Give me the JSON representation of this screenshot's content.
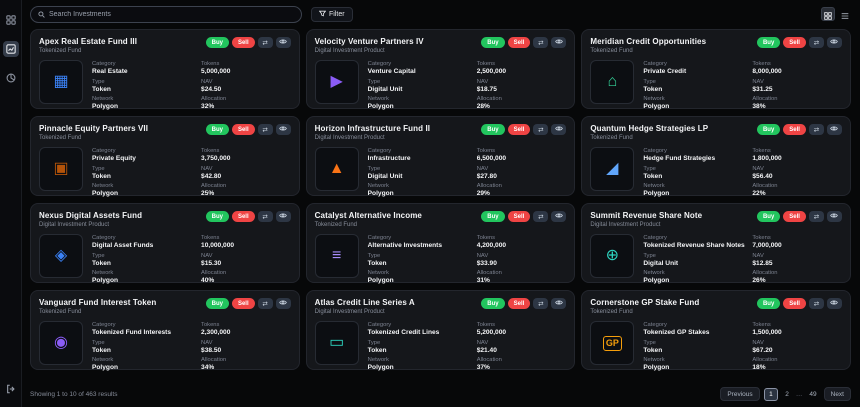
{
  "sidebar": {
    "items": [
      {
        "icon": "dashboard-icon",
        "active": false
      },
      {
        "icon": "investments-icon",
        "active": true
      },
      {
        "icon": "analytics-icon",
        "active": false
      }
    ],
    "logout_icon": "logout-icon"
  },
  "topbar": {
    "search_placeholder": "Search Investments",
    "filter_label": "Filter",
    "view_modes": [
      "grid",
      "list"
    ],
    "active_view": "grid"
  },
  "card_labels": {
    "category": "Category",
    "type": "Type",
    "network": "Network",
    "tokens": "Tokens",
    "nav": "NAV",
    "allocation": "Allocation",
    "buy": "Buy",
    "sell": "Sell"
  },
  "cards": [
    {
      "title": "Apex Real Estate Fund III",
      "subtitle": "Tokenized Fund",
      "category": "Real Estate",
      "tokens": "5,000,000",
      "type": "Token",
      "nav": "$24.50",
      "network": "Polygon",
      "allocation": "32%",
      "icon": "building-icon",
      "glyph": "▦",
      "color": "#3b82f6"
    },
    {
      "title": "Velocity Venture Partners IV",
      "subtitle": "Digital Investment Product",
      "category": "Venture Capital",
      "tokens": "2,500,000",
      "type": "Digital Unit",
      "nav": "$18.75",
      "network": "Polygon",
      "allocation": "28%",
      "icon": "play-circle-icon",
      "glyph": "▶",
      "color": "#8b5cf6"
    },
    {
      "title": "Meridian Credit Opportunities",
      "subtitle": "Tokenized Fund",
      "category": "Private Credit",
      "tokens": "8,000,000",
      "type": "Token",
      "nav": "$31.25",
      "network": "Polygon",
      "allocation": "38%",
      "icon": "shield-home-icon",
      "glyph": "⌂",
      "color": "#34d399"
    },
    {
      "title": "Pinnacle Equity Partners VII",
      "subtitle": "Tokenized Fund",
      "category": "Private Equity",
      "tokens": "3,750,000",
      "type": "Token",
      "nav": "$42.80",
      "network": "Polygon",
      "allocation": "25%",
      "icon": "frame-icon",
      "glyph": "▣",
      "color": "#b45309"
    },
    {
      "title": "Horizon Infrastructure Fund II",
      "subtitle": "Digital Investment Product",
      "category": "Infrastructure",
      "tokens": "6,500,000",
      "type": "Digital Unit",
      "nav": "$27.80",
      "network": "Polygon",
      "allocation": "29%",
      "icon": "triangle-icon",
      "glyph": "▲",
      "color": "#f97316"
    },
    {
      "title": "Quantum Hedge Strategies LP",
      "subtitle": "Tokenized Fund",
      "category": "Hedge Fund Strategies",
      "tokens": "1,800,000",
      "type": "Token",
      "nav": "$56.40",
      "network": "Polygon",
      "allocation": "22%",
      "icon": "area-chart-icon",
      "glyph": "◢",
      "color": "#60a5fa"
    },
    {
      "title": "Nexus Digital Assets Fund",
      "subtitle": "Digital Investment Product",
      "category": "Digital Asset Funds",
      "tokens": "10,000,000",
      "type": "Token",
      "nav": "$15.30",
      "network": "Polygon",
      "allocation": "40%",
      "icon": "shield-icon",
      "glyph": "◈",
      "color": "#3b82f6"
    },
    {
      "title": "Catalyst Alternative Income",
      "subtitle": "Tokenized Fund",
      "category": "Alternative Investments",
      "tokens": "4,200,000",
      "type": "Token",
      "nav": "$33.90",
      "network": "Polygon",
      "allocation": "31%",
      "icon": "stacked-lines-icon",
      "glyph": "≡",
      "color": "#a78bfa"
    },
    {
      "title": "Summit Revenue Share Note",
      "subtitle": "Digital Investment Product",
      "category": "Tokenized Revenue Share Notes",
      "tokens": "7,000,000",
      "type": "Digital Unit",
      "nav": "$12.85",
      "network": "Polygon",
      "allocation": "26%",
      "icon": "target-icon",
      "glyph": "⊕",
      "color": "#2dd4bf"
    },
    {
      "title": "Vanguard Fund Interest Token",
      "subtitle": "Tokenized Fund",
      "category": "Tokenized Fund Interests",
      "tokens": "2,300,000",
      "type": "Token",
      "nav": "$38.50",
      "network": "Polygon",
      "allocation": "34%",
      "icon": "ring-icon",
      "glyph": "◉",
      "color": "#8b5cf6"
    },
    {
      "title": "Atlas Credit Line Series A",
      "subtitle": "Digital Investment Product",
      "category": "Tokenized Credit Lines",
      "tokens": "5,200,000",
      "type": "Token",
      "nav": "$21.40",
      "network": "Polygon",
      "allocation": "37%",
      "icon": "credit-card-icon",
      "glyph": "▭",
      "color": "#2dd4bf"
    },
    {
      "title": "Cornerstone GP Stake Fund",
      "subtitle": "Tokenized Fund",
      "category": "Tokenized GP Stakes",
      "tokens": "1,500,000",
      "type": "Token",
      "nav": "$67.20",
      "network": "Polygon",
      "allocation": "18%",
      "icon": "gp-badge-icon",
      "glyph": "GP",
      "color": "#f59e0b"
    }
  ],
  "footer": {
    "summary": "Showing 1 to 10 of 463 results",
    "pagination": {
      "previous": "Previous",
      "pages": [
        "1",
        "2",
        "…",
        "49"
      ],
      "active_page": "1",
      "next": "Next"
    }
  },
  "colors": {
    "buy": "#22c55e",
    "sell": "#ef4444",
    "card_bg": "#15171b",
    "page_bg": "#070809",
    "accent_text": "#f4f5f7",
    "muted_text": "#7c8290"
  }
}
